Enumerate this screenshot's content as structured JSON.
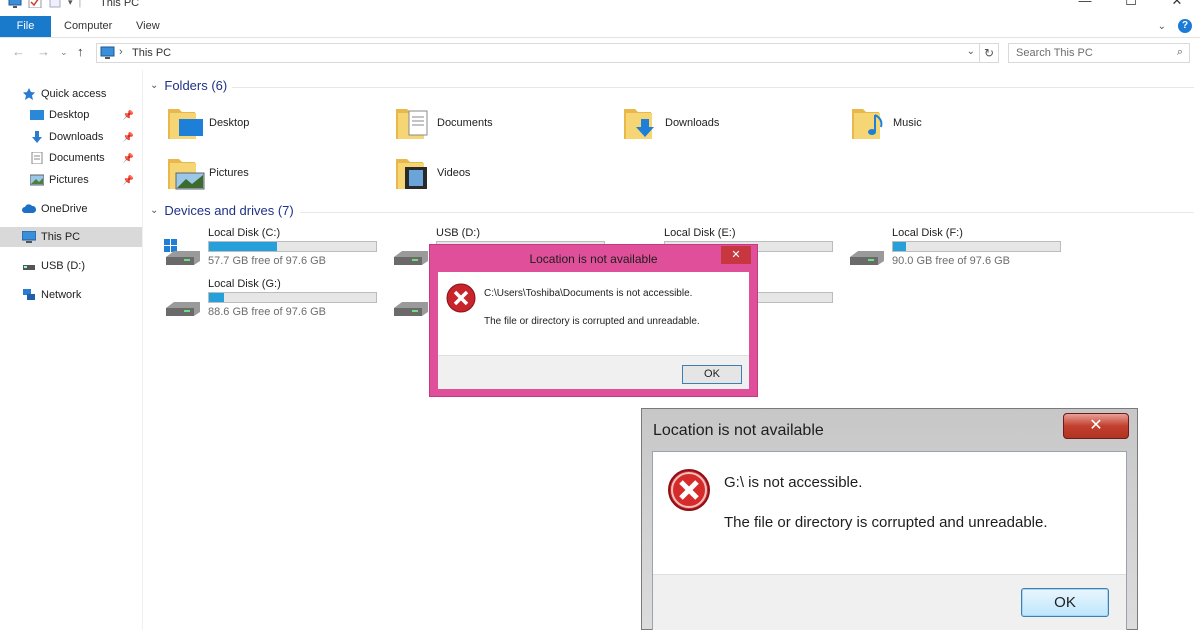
{
  "window": {
    "title": "This PC",
    "controls": {
      "minimize": "—",
      "maximize": "☐",
      "close": "✕"
    }
  },
  "ribbon": {
    "tabs": [
      "File",
      "Computer",
      "View"
    ]
  },
  "address": {
    "separator": "›",
    "path": "This PC",
    "dropdown": "⌄",
    "refresh": "↻"
  },
  "search": {
    "placeholder": "Search This PC"
  },
  "sidebar": {
    "items": [
      {
        "label": "Quick access",
        "icon": "star-icon"
      },
      {
        "label": "Desktop",
        "icon": "desktop-icon",
        "pinned": true
      },
      {
        "label": "Downloads",
        "icon": "download-arrow-icon",
        "pinned": true
      },
      {
        "label": "Documents",
        "icon": "document-icon",
        "pinned": true
      },
      {
        "label": "Pictures",
        "icon": "pictures-icon",
        "pinned": true
      },
      {
        "label": "OneDrive",
        "icon": "cloud-icon"
      },
      {
        "label": "This PC",
        "icon": "computer-icon",
        "selected": true
      },
      {
        "label": "USB (D:)",
        "icon": "usb-drive-icon"
      },
      {
        "label": "Network",
        "icon": "network-icon"
      }
    ]
  },
  "folders": {
    "header": "Folders (6)",
    "items": [
      {
        "label": "Desktop"
      },
      {
        "label": "Documents"
      },
      {
        "label": "Downloads"
      },
      {
        "label": "Music"
      },
      {
        "label": "Pictures"
      },
      {
        "label": "Videos"
      }
    ]
  },
  "drives": {
    "header": "Devices and drives (7)",
    "items": [
      {
        "label": "Local Disk (C:)",
        "free": "57.7 GB free of 97.6 GB",
        "used_fraction": 0.41
      },
      {
        "label": "USB (D:)",
        "free": "",
        "used_fraction": 0
      },
      {
        "label": "Local Disk (E:)",
        "free": "",
        "used_fraction": 0
      },
      {
        "label": "Local Disk (F:)",
        "free": "90.0 GB free of 97.6 GB",
        "used_fraction": 0.08
      },
      {
        "label": "Local Disk (G:)",
        "free": "88.6 GB free of 97.6 GB",
        "used_fraction": 0.09
      }
    ]
  },
  "dialog1": {
    "title": "Location is not available",
    "close": "✕",
    "message1": "C:\\Users\\Toshiba\\Documents is not accessible.",
    "message2": "The file or directory is corrupted and unreadable.",
    "ok": "OK",
    "border_color": "#e0509a"
  },
  "dialog2": {
    "title": "Location is not available",
    "close": "✕",
    "message1": "G:\\ is not accessible.",
    "message2": "The file or directory is corrupted and unreadable.",
    "ok": "OK"
  },
  "colors": {
    "accent": "#1979ca",
    "drive_bar": "#26a0da",
    "error_red": "#c7373f"
  }
}
